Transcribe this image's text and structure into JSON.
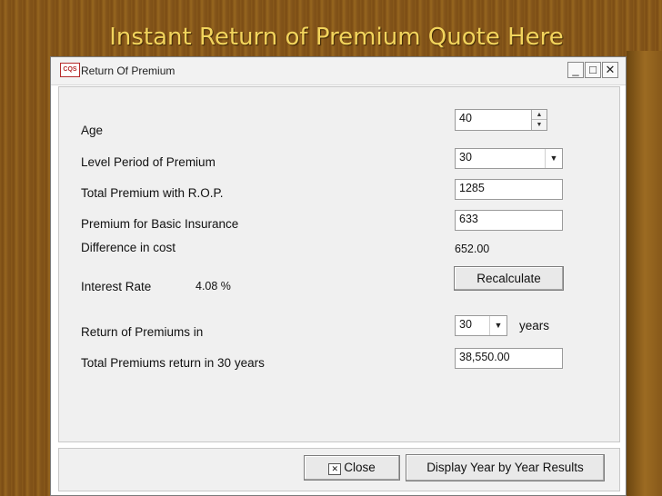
{
  "slide": {
    "title": "Instant Return of Premium Quote Here"
  },
  "window": {
    "title": "Return Of Premium",
    "app_icon_text": "CQS",
    "controls": {
      "minimize": "_",
      "maximize": "□",
      "close": "✕"
    }
  },
  "form": {
    "age": {
      "label": "Age",
      "value": "40"
    },
    "level_period": {
      "label": "Level Period of Premium",
      "value": "30"
    },
    "total_premium": {
      "label": "Total Premium with R.O.P.",
      "value": "1285"
    },
    "basic_premium": {
      "label": "Premium for Basic Insurance",
      "value": "633"
    },
    "difference": {
      "label": "Difference in cost",
      "value": "652.00"
    },
    "interest": {
      "label": "Interest Rate",
      "value": "4.08 %"
    },
    "recalculate_label": "Recalculate",
    "return_in": {
      "label": "Return of Premiums in",
      "value": "30",
      "unit": "years"
    },
    "total_return": {
      "label": "Total Premiums return in 30 years",
      "value": "38,550.00"
    }
  },
  "footer": {
    "close_label": "Close",
    "close_icon": "close-x-icon",
    "display_label": "Display Year by Year Results"
  }
}
